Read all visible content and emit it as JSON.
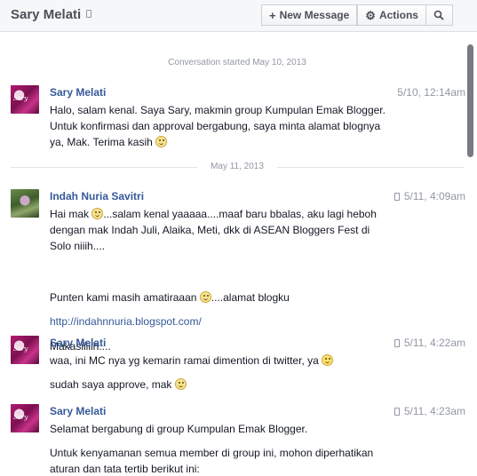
{
  "header": {
    "title": "Sary Melati",
    "new_message_label": "New Message",
    "actions_label": "Actions"
  },
  "dividers": {
    "started": "Conversation started May 10, 2013",
    "date2": "May 11, 2013"
  },
  "messages": [
    {
      "sender": "Sary Melati",
      "time": "5/10, 12:14am",
      "mobile": false,
      "text1": "Halo, salam kenal. Saya Sary, makmin group Kumpulan Emak Blogger.",
      "text2": "Untuk konfirmasi dan approval bergabung, saya minta alamat blognya",
      "text3": "ya, Mak. Terima kasih"
    },
    {
      "sender": "Indah Nuria Savitri",
      "time": "5/11, 4:09am",
      "mobile": true,
      "p1_a": "Hai mak",
      "p1_b": "...salam kenal yaaaaa....maaf baru bbalas, aku lagi heboh",
      "p1_c": "dengan mak Indah Juli, Alaika, Meti, dkk di ASEAN Bloggers Fest di",
      "p1_d": "Solo niiih....",
      "p2_a": "Punten kami masih amatiraaan",
      "p2_b": "....alamat blogku",
      "link": "http://indahnnuria.blogspot.com/",
      "p4": "Makasiiiiih...."
    },
    {
      "sender": "Sary Melati",
      "time": "5/11, 4:22am",
      "mobile": true,
      "p1": "waa, ini MC nya yg kemarin ramai dimention di twitter, ya",
      "p2": "sudah saya approve, mak"
    },
    {
      "sender": "Sary Melati",
      "time": "5/11, 4:23am",
      "mobile": true,
      "p1": "Selamat bergabung di group Kumpulan Emak Blogger.",
      "p2_a": "Untuk kenyamanan semua member di group ini, mohon diperhatikan",
      "p2_b": "aturan dan tata tertib berikut ini:"
    }
  ]
}
